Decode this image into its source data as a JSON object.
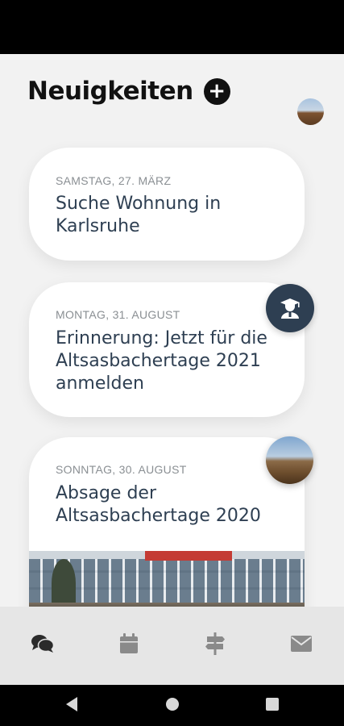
{
  "header": {
    "title": "Neuigkeiten",
    "add_label": "+"
  },
  "news": [
    {
      "date": "SAMSTAG, 27. MÄRZ",
      "title": "Suche Wohnung in Karlsruhe",
      "author_icon": "graduate-user-icon"
    },
    {
      "date": "MONTAG, 31. AUGUST",
      "title": "Erinnerung: Jetzt für die Altsasbachertage 2021 anmelden",
      "author_icon": "landscape-avatar"
    },
    {
      "date": "SONNTAG, 30. AUGUST",
      "title": "Absage der Altsasbachertage 2020",
      "image": "building-photo"
    }
  ],
  "bottom_nav": [
    {
      "icon": "chat-bubbles-icon",
      "active": true
    },
    {
      "icon": "calendar-icon",
      "active": false
    },
    {
      "icon": "signpost-icon",
      "active": false
    },
    {
      "icon": "envelope-icon",
      "active": false
    }
  ],
  "colors": {
    "accent": "#2e3f52",
    "date_text": "#8a8f93",
    "background": "#f2f2f2",
    "nav_background": "#e6e6e6",
    "nav_icon": "#8a8a8a",
    "nav_icon_active": "#2b2b2b"
  }
}
